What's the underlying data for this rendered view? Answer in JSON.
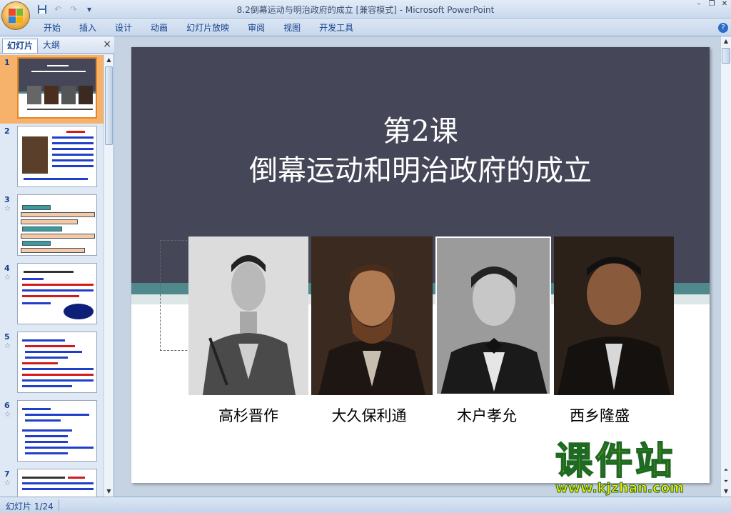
{
  "window": {
    "title": "8.2倒幕运动与明治政府的成立 [兼容模式] - Microsoft PowerPoint"
  },
  "qat": {
    "save_icon": "save-icon",
    "undo_icon": "undo-icon",
    "redo_icon": "redo-icon"
  },
  "ribbon": {
    "tabs": [
      "开始",
      "插入",
      "设计",
      "动画",
      "幻灯片放映",
      "审阅",
      "视图",
      "开发工具"
    ],
    "help": "?"
  },
  "left_pane": {
    "tab_slides": "幻灯片",
    "tab_outline": "大纲",
    "close": "×",
    "thumbnails": [
      {
        "num": "1"
      },
      {
        "num": "2"
      },
      {
        "num": "3"
      },
      {
        "num": "4"
      },
      {
        "num": "5"
      },
      {
        "num": "6"
      },
      {
        "num": "7"
      }
    ]
  },
  "slide": {
    "title_line1": "第2课",
    "title_line2": "倒幕运动和明治政府的成立",
    "people": [
      {
        "name": "高杉晋作"
      },
      {
        "name": "大久保利通"
      },
      {
        "name": "木户孝允"
      },
      {
        "name": "西乡隆盛"
      }
    ]
  },
  "watermark": {
    "line1": "课件站",
    "line2": "www.kjzhan.com"
  },
  "status": {
    "slide_counter": "幻灯片 1/24"
  }
}
